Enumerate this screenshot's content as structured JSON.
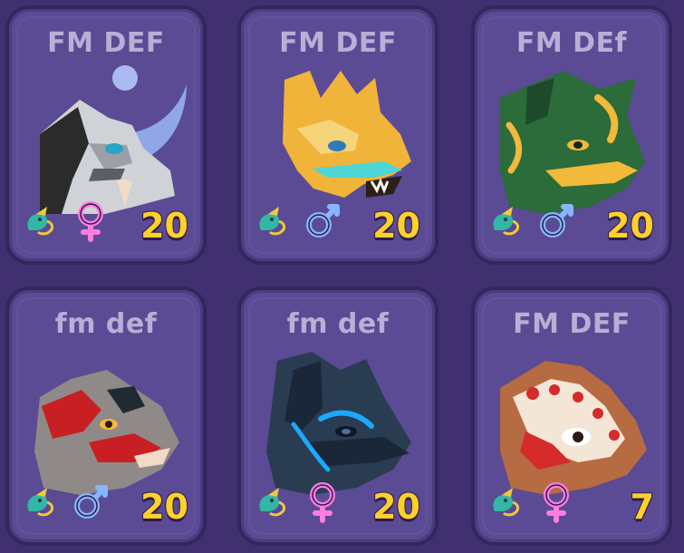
{
  "cards": [
    {
      "title": "FM DEF",
      "level": "20",
      "gender": "female",
      "species_icon": "dragon-icon",
      "dragon": "black-white-horned-dragon",
      "colors": {
        "main": "#cfd2d6",
        "accent": "#2b2b2b",
        "horn": "#8fa7e8"
      }
    },
    {
      "title": "FM DEF",
      "level": "20",
      "gender": "male",
      "species_icon": "dragon-icon",
      "dragon": "golden-dragon",
      "colors": {
        "main": "#f0b43a",
        "accent": "#4cd6d6",
        "horn": "#f6d47a"
      }
    },
    {
      "title": "FM DEf",
      "level": "20",
      "gender": "male",
      "species_icon": "dragon-icon",
      "dragon": "green-gold-dragon",
      "colors": {
        "main": "#2c6b3a",
        "accent": "#f2b93b",
        "horn": "#1d4a2b"
      }
    },
    {
      "title": "fm def",
      "level": "20",
      "gender": "male",
      "species_icon": "dragon-icon",
      "dragon": "red-gray-dragon",
      "colors": {
        "main": "#8f8a87",
        "accent": "#c81f25",
        "horn": "#202a33"
      }
    },
    {
      "title": "fm def",
      "level": "20",
      "gender": "female",
      "species_icon": "dragon-icon",
      "dragon": "dark-blue-dragon",
      "colors": {
        "main": "#2a3c52",
        "accent": "#1aa9ff",
        "horn": "#1a2738"
      }
    },
    {
      "title": "FM DEF",
      "level": "7",
      "gender": "female",
      "species_icon": "dragon-icon",
      "dragon": "gingerbread-dragon",
      "colors": {
        "main": "#b76b42",
        "accent": "#f4e6d6",
        "horn": "#b76b42"
      }
    }
  ]
}
